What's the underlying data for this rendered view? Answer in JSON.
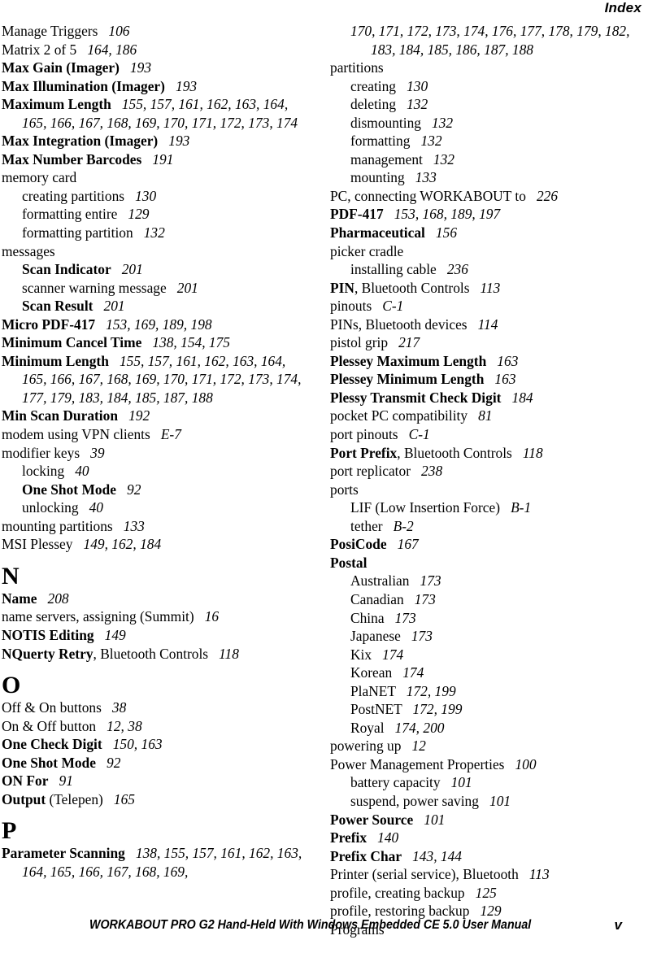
{
  "header": {
    "running_head": "Index"
  },
  "footer": {
    "manual_title": "WORKABOUT PRO G2 Hand-Held With Windows Embedded CE 5.0 User Manual",
    "page_number": "v"
  },
  "left_column": [
    {
      "kind": "entry",
      "level": 0,
      "bold": false,
      "term": "Manage Triggers",
      "pages": "106"
    },
    {
      "kind": "entry",
      "level": 0,
      "bold": false,
      "term": "Matrix 2 of 5",
      "pages": "164, 186"
    },
    {
      "kind": "entry",
      "level": 0,
      "bold": true,
      "term": "Max Gain (Imager)",
      "pages": "193"
    },
    {
      "kind": "entry",
      "level": 0,
      "bold": true,
      "term": "Max Illumination (Imager)",
      "pages": "193"
    },
    {
      "kind": "entry",
      "level": 0,
      "bold": true,
      "term": "Maximum Length",
      "pages": "155, 157, 161, 162, 163, 164, 165, 166, 167, 168, 169, 170, 171, 172, 173, 174"
    },
    {
      "kind": "entry",
      "level": 0,
      "bold": true,
      "term": "Max Integration (Imager)",
      "pages": "193"
    },
    {
      "kind": "entry",
      "level": 0,
      "bold": true,
      "term": "Max Number Barcodes",
      "pages": "191"
    },
    {
      "kind": "entry",
      "level": 0,
      "bold": false,
      "term": "memory card",
      "pages": ""
    },
    {
      "kind": "entry",
      "level": 1,
      "bold": false,
      "term": "creating partitions",
      "pages": "130"
    },
    {
      "kind": "entry",
      "level": 1,
      "bold": false,
      "term": "formatting entire",
      "pages": "129"
    },
    {
      "kind": "entry",
      "level": 1,
      "bold": false,
      "term": "formatting partition",
      "pages": "132"
    },
    {
      "kind": "entry",
      "level": 0,
      "bold": false,
      "term": "messages",
      "pages": ""
    },
    {
      "kind": "entry",
      "level": 1,
      "bold": true,
      "term": "Scan Indicator",
      "pages": "201"
    },
    {
      "kind": "entry",
      "level": 1,
      "bold": false,
      "term": "scanner warning message",
      "pages": "201"
    },
    {
      "kind": "entry",
      "level": 1,
      "bold": true,
      "term": "Scan Result",
      "pages": "201"
    },
    {
      "kind": "entry",
      "level": 0,
      "bold": true,
      "term": "Micro PDF-417",
      "pages": "153, 169, 189, 198"
    },
    {
      "kind": "entry",
      "level": 0,
      "bold": true,
      "term": "Minimum Cancel Time",
      "pages": "138, 154, 175"
    },
    {
      "kind": "entry",
      "level": 0,
      "bold": true,
      "term": "Minimum Length",
      "pages": "155, 157, 161, 162, 163, 164, 165, 166, 167, 168, 169, 170, 171, 172, 173, 174, 177, 179, 183, 184, 185, 187, 188"
    },
    {
      "kind": "entry",
      "level": 0,
      "bold": true,
      "term": "Min Scan Duration",
      "pages": "192"
    },
    {
      "kind": "entry",
      "level": 0,
      "bold": false,
      "term": "modem using VPN clients",
      "pages": "E-7"
    },
    {
      "kind": "entry",
      "level": 0,
      "bold": false,
      "term": "modifier keys",
      "pages": "39"
    },
    {
      "kind": "entry",
      "level": 1,
      "bold": false,
      "term": "locking",
      "pages": "40"
    },
    {
      "kind": "entry",
      "level": 1,
      "bold": true,
      "term": "One Shot Mode",
      "pages": "92"
    },
    {
      "kind": "entry",
      "level": 1,
      "bold": false,
      "term": "unlocking",
      "pages": "40"
    },
    {
      "kind": "entry",
      "level": 0,
      "bold": false,
      "term": "mounting partitions",
      "pages": "133"
    },
    {
      "kind": "entry",
      "level": 0,
      "bold": false,
      "term": "MSI Plessey",
      "pages": "149, 162, 184"
    },
    {
      "kind": "letter",
      "letter": "N"
    },
    {
      "kind": "entry",
      "level": 0,
      "bold": true,
      "term": "Name",
      "pages": "208"
    },
    {
      "kind": "entry",
      "level": 0,
      "bold": false,
      "term": "name servers, assigning (Summit)",
      "pages": "16"
    },
    {
      "kind": "entry",
      "level": 0,
      "bold": true,
      "term": "NOTIS Editing",
      "pages": "149"
    },
    {
      "kind": "entry",
      "level": 0,
      "bold": true,
      "term": "NQuerty Retry",
      "term_tail": ", Bluetooth Controls",
      "pages": "118"
    },
    {
      "kind": "letter",
      "letter": "O"
    },
    {
      "kind": "entry",
      "level": 0,
      "bold": false,
      "term": "Off & On buttons",
      "pages": "38"
    },
    {
      "kind": "entry",
      "level": 0,
      "bold": false,
      "term": "On & Off button",
      "pages": "12, 38"
    },
    {
      "kind": "entry",
      "level": 0,
      "bold": true,
      "term": "One Check Digit",
      "pages": "150, 163"
    },
    {
      "kind": "entry",
      "level": 0,
      "bold": true,
      "term": "One Shot Mode",
      "pages": "92"
    },
    {
      "kind": "entry",
      "level": 0,
      "bold": true,
      "term": "ON For",
      "pages": "91"
    },
    {
      "kind": "entry",
      "level": 0,
      "bold": true,
      "term": "Output",
      "term_tail": " (Telepen)",
      "pages": "165"
    },
    {
      "kind": "letter",
      "letter": "P"
    },
    {
      "kind": "entry",
      "level": 0,
      "bold": true,
      "term": "Parameter Scanning",
      "pages": "138, 155, 157, 161, 162, 163, 164, 165, 166, 167, 168, 169,"
    }
  ],
  "right_column": [
    {
      "kind": "cont",
      "level": 1,
      "pages": "170, 171, 172, 173, 174, 176, 177, 178, 179, 182, 183, 184, 185, 186, 187, 188"
    },
    {
      "kind": "entry",
      "level": 0,
      "bold": false,
      "term": "partitions",
      "pages": ""
    },
    {
      "kind": "entry",
      "level": 1,
      "bold": false,
      "term": "creating",
      "pages": "130"
    },
    {
      "kind": "entry",
      "level": 1,
      "bold": false,
      "term": "deleting",
      "pages": "132"
    },
    {
      "kind": "entry",
      "level": 1,
      "bold": false,
      "term": "dismounting",
      "pages": "132"
    },
    {
      "kind": "entry",
      "level": 1,
      "bold": false,
      "term": "formatting",
      "pages": "132"
    },
    {
      "kind": "entry",
      "level": 1,
      "bold": false,
      "term": "management",
      "pages": "132"
    },
    {
      "kind": "entry",
      "level": 1,
      "bold": false,
      "term": "mounting",
      "pages": "133"
    },
    {
      "kind": "entry",
      "level": 0,
      "bold": false,
      "term": "PC, connecting WORKABOUT to",
      "pages": "226"
    },
    {
      "kind": "entry",
      "level": 0,
      "bold": true,
      "term": "PDF-417",
      "pages": "153, 168, 189, 197"
    },
    {
      "kind": "entry",
      "level": 0,
      "bold": true,
      "term": "Pharmaceutical",
      "pages": "156"
    },
    {
      "kind": "entry",
      "level": 0,
      "bold": false,
      "term": "picker cradle",
      "pages": ""
    },
    {
      "kind": "entry",
      "level": 1,
      "bold": false,
      "term": "installing cable",
      "pages": "236"
    },
    {
      "kind": "entry",
      "level": 0,
      "bold": true,
      "term": "PIN",
      "term_tail": ", Bluetooth Controls",
      "pages": "113"
    },
    {
      "kind": "entry",
      "level": 0,
      "bold": false,
      "term": "pinouts",
      "pages": "C-1"
    },
    {
      "kind": "entry",
      "level": 0,
      "bold": false,
      "term": "PINs, Bluetooth devices",
      "pages": "114"
    },
    {
      "kind": "entry",
      "level": 0,
      "bold": false,
      "term": "pistol grip",
      "pages": "217"
    },
    {
      "kind": "entry",
      "level": 0,
      "bold": true,
      "term": "Plessey Maximum Length",
      "pages": "163"
    },
    {
      "kind": "entry",
      "level": 0,
      "bold": true,
      "term": "Plessey Minimum Length",
      "pages": "163"
    },
    {
      "kind": "entry",
      "level": 0,
      "bold": true,
      "term": "Plessy Transmit Check Digit",
      "pages": "184"
    },
    {
      "kind": "entry",
      "level": 0,
      "bold": false,
      "term": "pocket PC compatibility",
      "pages": "81"
    },
    {
      "kind": "entry",
      "level": 0,
      "bold": false,
      "term": "port pinouts",
      "pages": "C-1"
    },
    {
      "kind": "entry",
      "level": 0,
      "bold": true,
      "term": "Port Prefix",
      "term_tail": ", Bluetooth Controls",
      "pages": "118"
    },
    {
      "kind": "entry",
      "level": 0,
      "bold": false,
      "term": "port replicator",
      "pages": "238"
    },
    {
      "kind": "entry",
      "level": 0,
      "bold": false,
      "term": "ports",
      "pages": ""
    },
    {
      "kind": "entry",
      "level": 1,
      "bold": false,
      "term": "LIF (Low Insertion Force)",
      "pages": "B-1"
    },
    {
      "kind": "entry",
      "level": 1,
      "bold": false,
      "term": "tether",
      "pages": "B-2"
    },
    {
      "kind": "entry",
      "level": 0,
      "bold": true,
      "term": "PosiCode",
      "pages": "167"
    },
    {
      "kind": "entry",
      "level": 0,
      "bold": true,
      "term": "Postal",
      "pages": ""
    },
    {
      "kind": "entry",
      "level": 1,
      "bold": false,
      "term": "Australian",
      "pages": "173"
    },
    {
      "kind": "entry",
      "level": 1,
      "bold": false,
      "term": "Canadian",
      "pages": "173"
    },
    {
      "kind": "entry",
      "level": 1,
      "bold": false,
      "term": "China",
      "pages": "173"
    },
    {
      "kind": "entry",
      "level": 1,
      "bold": false,
      "term": "Japanese",
      "pages": "173"
    },
    {
      "kind": "entry",
      "level": 1,
      "bold": false,
      "term": "Kix",
      "pages": "174"
    },
    {
      "kind": "entry",
      "level": 1,
      "bold": false,
      "term": "Korean",
      "pages": "174"
    },
    {
      "kind": "entry",
      "level": 1,
      "bold": false,
      "term": "PlaNET",
      "pages": "172, 199"
    },
    {
      "kind": "entry",
      "level": 1,
      "bold": false,
      "term": "PostNET",
      "pages": "172, 199"
    },
    {
      "kind": "entry",
      "level": 1,
      "bold": false,
      "term": "Royal",
      "pages": "174, 200"
    },
    {
      "kind": "entry",
      "level": 0,
      "bold": false,
      "term": "powering up",
      "pages": "12"
    },
    {
      "kind": "entry",
      "level": 0,
      "bold": false,
      "term": "Power Management Properties",
      "pages": "100"
    },
    {
      "kind": "entry",
      "level": 1,
      "bold": false,
      "term": "battery capacity",
      "pages": "101"
    },
    {
      "kind": "entry",
      "level": 1,
      "bold": false,
      "term": "suspend, power saving",
      "pages": "101"
    },
    {
      "kind": "entry",
      "level": 0,
      "bold": true,
      "term": "Power Source",
      "pages": "101"
    },
    {
      "kind": "entry",
      "level": 0,
      "bold": true,
      "term": "Prefix",
      "pages": "140"
    },
    {
      "kind": "entry",
      "level": 0,
      "bold": true,
      "term": "Prefix Char",
      "pages": "143, 144"
    },
    {
      "kind": "entry",
      "level": 0,
      "bold": false,
      "term": "Printer (serial service), Bluetooth",
      "pages": "113"
    },
    {
      "kind": "entry",
      "level": 0,
      "bold": false,
      "term": "profile, creating backup",
      "pages": "125"
    },
    {
      "kind": "entry",
      "level": 0,
      "bold": false,
      "term": "profile, restoring backup",
      "pages": "129"
    },
    {
      "kind": "entry",
      "level": 0,
      "bold": false,
      "term": "Programs",
      "pages": ""
    }
  ]
}
